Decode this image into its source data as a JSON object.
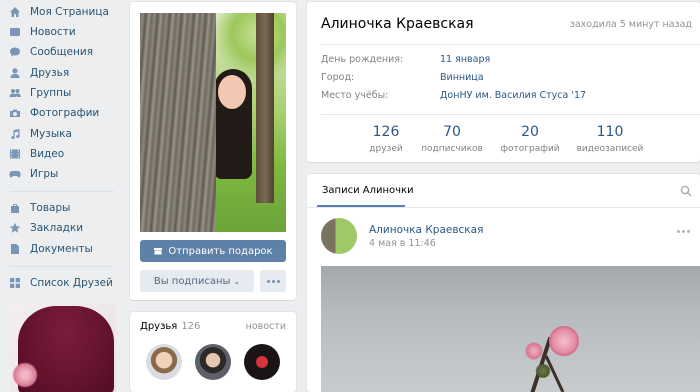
{
  "sidebar": {
    "items": [
      {
        "label": "Моя Страница",
        "icon": "home-icon"
      },
      {
        "label": "Новости",
        "icon": "news-icon"
      },
      {
        "label": "Сообщения",
        "icon": "messages-icon"
      },
      {
        "label": "Друзья",
        "icon": "friend-icon"
      },
      {
        "label": "Группы",
        "icon": "groups-icon"
      },
      {
        "label": "Фотографии",
        "icon": "camera-icon"
      },
      {
        "label": "Музыка",
        "icon": "music-icon"
      },
      {
        "label": "Видео",
        "icon": "video-icon"
      },
      {
        "label": "Игры",
        "icon": "gamepad-icon"
      },
      {
        "label": "Товары",
        "icon": "bag-icon"
      },
      {
        "label": "Закладки",
        "icon": "star-icon"
      },
      {
        "label": "Документы",
        "icon": "document-icon"
      },
      {
        "label": "Список Друзей",
        "icon": "grid-icon"
      }
    ]
  },
  "profile_actions": {
    "gift_label": "Отправить подарок",
    "subscribed_label": "Вы подписаны"
  },
  "friends": {
    "title": "Друзья",
    "count": "126",
    "link": "новости"
  },
  "profile": {
    "name": "Алиночка Краевская",
    "last_seen": "заходила 5 минут назад",
    "details": [
      {
        "key": "День рождения:",
        "value": "11 января"
      },
      {
        "key": "Город:",
        "value": "Винница"
      },
      {
        "key": "Место учёбы:",
        "value": "ДонНУ им. Василия Стуса '17"
      }
    ],
    "counters": [
      {
        "value": "126",
        "label": "друзей"
      },
      {
        "value": "70",
        "label": "подписчиков"
      },
      {
        "value": "20",
        "label": "фотографий"
      },
      {
        "value": "110",
        "label": "видеозаписей"
      }
    ]
  },
  "wall": {
    "tab": "Записи Алиночки",
    "post": {
      "author": "Алиночка Краевская",
      "date": "4 мая в 11:46"
    }
  },
  "colors": {
    "background": "#edeef0",
    "link": "#2a5885",
    "button_primary": "#5e81a8",
    "icon": "#7996b9"
  }
}
